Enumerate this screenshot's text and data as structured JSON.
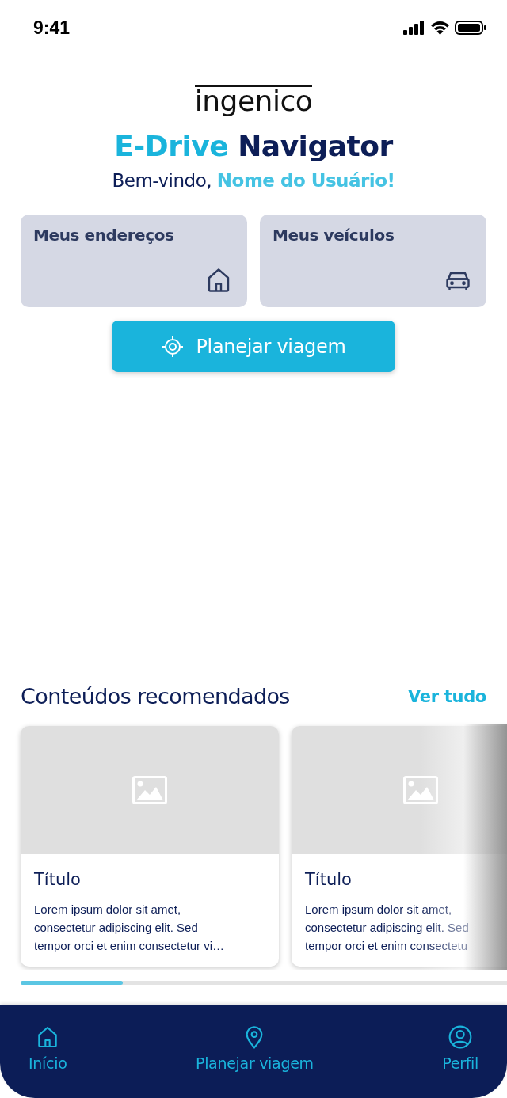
{
  "status_bar": {
    "time": "9:41"
  },
  "logo": {
    "text": "ingenico"
  },
  "title": {
    "accent": "E-Drive",
    "main": "Navigator"
  },
  "welcome": {
    "greeting": "Bem-vindo,",
    "user": "Nome do Usuário!"
  },
  "tiles": [
    {
      "label": "Meus endereços",
      "kind": "home"
    },
    {
      "label": "Meus veículos",
      "kind": "car"
    }
  ],
  "primary_button": {
    "label": "Planejar viagem"
  },
  "recommended": {
    "heading": "Conteúdos recomendados",
    "link": "Ver tudo",
    "cards": [
      {
        "title": "Título",
        "body": "Lorem ipsum dolor sit amet,\nconsectetur adipiscing elit. Sed\ntempor orci et enim consectetur vi…",
        "kind": "picture"
      },
      {
        "title": "Título",
        "body": "Lorem ipsum dolor sit amet,\nconsectetur adipiscing elit. Sed\ntempor orci et enim consectetu",
        "kind": "picture"
      }
    ],
    "scroll": {
      "level": 0.21
    }
  },
  "nav": [
    {
      "label": "Início",
      "kind": "home"
    },
    {
      "label": "Planejar viagem",
      "kind": "pin"
    },
    {
      "label": "Perfil",
      "kind": "user"
    }
  ]
}
